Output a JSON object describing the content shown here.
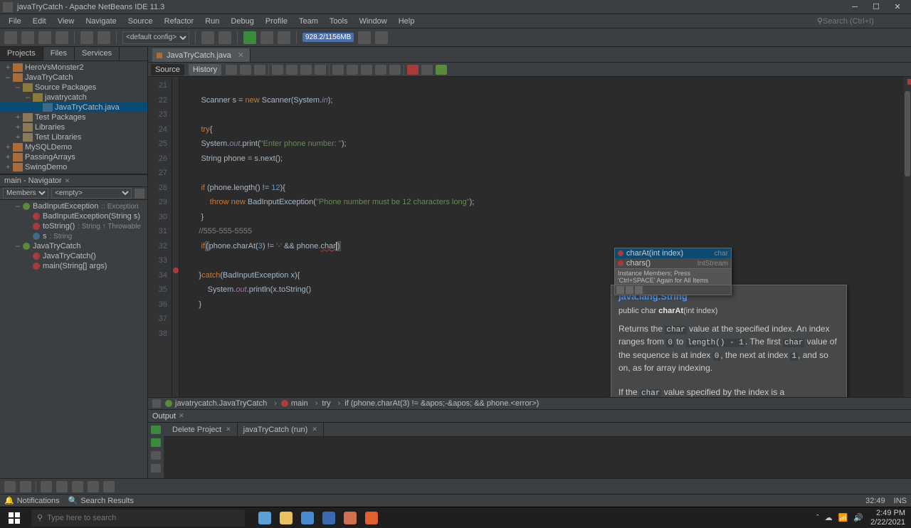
{
  "window": {
    "title": "javaTryCatch - Apache NetBeans IDE 11.3"
  },
  "menu": [
    "File",
    "Edit",
    "View",
    "Navigate",
    "Source",
    "Refactor",
    "Run",
    "Debug",
    "Profile",
    "Team",
    "Tools",
    "Window",
    "Help"
  ],
  "search_placeholder": "Search (Ctrl+I)",
  "toolbar": {
    "config": "<default config>",
    "memory": "928.2/1156MB"
  },
  "left_tabs": [
    "Projects",
    "Files",
    "Services"
  ],
  "left_tabs_active": 0,
  "projects": [
    {
      "label": "HeroVsMonster2",
      "lvl": 1,
      "icon": "coffee",
      "exp": "+"
    },
    {
      "label": "JavaTryCatch",
      "lvl": 1,
      "icon": "coffee",
      "exp": "–"
    },
    {
      "label": "Source Packages",
      "lvl": 2,
      "icon": "pkg",
      "exp": "–"
    },
    {
      "label": "javatrycatch",
      "lvl": 3,
      "icon": "pkg",
      "exp": "–"
    },
    {
      "label": "JavaTryCatch.java",
      "lvl": 4,
      "icon": "java",
      "exp": "",
      "selected": true
    },
    {
      "label": "Test Packages",
      "lvl": 2,
      "icon": "folder",
      "exp": "+"
    },
    {
      "label": "Libraries",
      "lvl": 2,
      "icon": "folder",
      "exp": "+"
    },
    {
      "label": "Test Libraries",
      "lvl": 2,
      "icon": "folder",
      "exp": "+"
    },
    {
      "label": "MySQLDemo",
      "lvl": 1,
      "icon": "coffee",
      "exp": "+"
    },
    {
      "label": "PassingArrays",
      "lvl": 1,
      "icon": "coffee",
      "exp": "+"
    },
    {
      "label": "SwingDemo",
      "lvl": 1,
      "icon": "coffee",
      "exp": "+"
    }
  ],
  "navigator": {
    "title": "main - Navigator",
    "members_label": "Members",
    "empty": "<empty>",
    "items": [
      {
        "label": "BadInputException",
        "type": ":: Exception",
        "icon": "class",
        "lvl": 1,
        "exp": "–"
      },
      {
        "label": "BadInputException(String s)",
        "type": "",
        "icon": "method",
        "lvl": 2,
        "exp": ""
      },
      {
        "label": "toString()",
        "type": ": String ↑ Throwable",
        "icon": "method",
        "lvl": 2,
        "exp": ""
      },
      {
        "label": "s",
        "type": ": String",
        "icon": "field",
        "lvl": 2,
        "exp": ""
      },
      {
        "label": "JavaTryCatch",
        "type": "",
        "icon": "class",
        "lvl": 1,
        "exp": "–"
      },
      {
        "label": "JavaTryCatch()",
        "type": "",
        "icon": "method",
        "lvl": 2,
        "exp": ""
      },
      {
        "label": "main(String[] args)",
        "type": "",
        "icon": "method",
        "lvl": 2,
        "exp": ""
      }
    ]
  },
  "editor": {
    "file_tab": "JavaTryCatch.java",
    "modes": [
      "Source",
      "History"
    ],
    "line_start": 21,
    "line_end": 38,
    "crumbs": [
      {
        "label": "javatrycatch.JavaTryCatch"
      },
      {
        "label": "main"
      },
      {
        "label": "try"
      },
      {
        "label": "if (phone.charAt(3) != &apos;-&apos; && phone.<error>)"
      }
    ]
  },
  "autocomplete": {
    "items": [
      {
        "name": "charAt(int index)",
        "ret": "char",
        "sel": true
      },
      {
        "name": "chars()",
        "ret": "IntStream",
        "sel": false
      }
    ],
    "hint": "Instance Members; Press 'Ctrl+SPACE' Again for All Items"
  },
  "doc": {
    "title": "java.lang.String",
    "sig_pre": "public char ",
    "sig_name": "charAt",
    "sig_args": "(int index)",
    "body_html": "Returns the <code>char</code> value at the specified index. An index ranges from <code>0</code> to <code>length() - 1</code>. The first <code>char</code> value of the sequence is at index <code>0</code>, the next at index <code>1</code>, and so on, as for array indexing.<br><br>If the <code>char</code> value specified by the index is a"
  },
  "output": {
    "title": "Output",
    "tabs": [
      {
        "label": "Delete Project"
      },
      {
        "label": "javaTryCatch (run)"
      }
    ]
  },
  "status": {
    "notifications": "Notifications",
    "search_results": "Search Results",
    "col": "32:49",
    "mode": "INS"
  },
  "taskbar": {
    "search_placeholder": "Type here to search",
    "time": "2:49 PM",
    "date": "2/22/2021"
  }
}
